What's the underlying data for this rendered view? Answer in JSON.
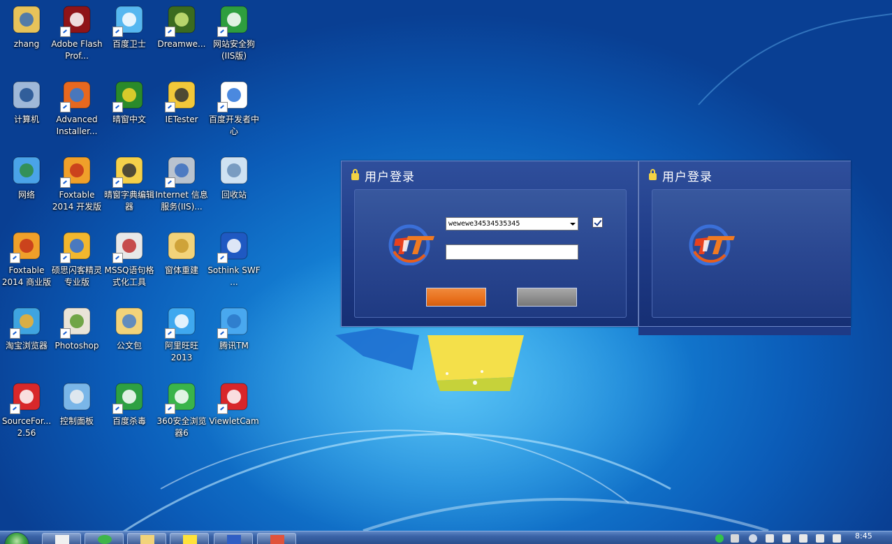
{
  "desktop": {
    "icons": [
      {
        "label": "zhang",
        "icon": "user-folder-icon"
      },
      {
        "label": "Adobe Flash Prof...",
        "icon": "flash-icon"
      },
      {
        "label": "百度卫士",
        "icon": "baidu-guard-icon"
      },
      {
        "label": "Dreamwe...",
        "icon": "dreamweaver-icon"
      },
      {
        "label": "网站安全狗(IIS版)",
        "icon": "safedog-icon"
      },
      {
        "label": "计算机",
        "icon": "computer-icon"
      },
      {
        "label": "Advanced Installer...",
        "icon": "advanced-installer-icon"
      },
      {
        "label": "晴窗中文",
        "icon": "qingchuang-icon"
      },
      {
        "label": "IETester",
        "icon": "ietester-icon"
      },
      {
        "label": "百度开发者中心",
        "icon": "baidu-dev-icon"
      },
      {
        "label": "网络",
        "icon": "network-icon"
      },
      {
        "label": "Foxtable 2014 开发版",
        "icon": "foxtable-icon"
      },
      {
        "label": "晴窗字典编辑器",
        "icon": "dictionary-editor-icon"
      },
      {
        "label": "Internet 信息服务(IIS)...",
        "icon": "iis-icon"
      },
      {
        "label": "回收站",
        "icon": "recycle-bin-icon"
      },
      {
        "label": "Foxtable 2014 商业版",
        "icon": "foxtable-icon"
      },
      {
        "label": "硕思闪客精灵 专业版",
        "icon": "sothink-decompiler-icon"
      },
      {
        "label": "MSSQ语句格式化工具",
        "icon": "sql-formatter-icon"
      },
      {
        "label": "窗体重建",
        "icon": "folder-icon"
      },
      {
        "label": "Sothink SWF ...",
        "icon": "sothink-swf-icon"
      },
      {
        "label": "淘宝浏览器",
        "icon": "taobao-browser-icon"
      },
      {
        "label": "Photoshop",
        "icon": "photoshop-icon"
      },
      {
        "label": "公文包",
        "icon": "briefcase-icon"
      },
      {
        "label": "阿里旺旺 2013",
        "icon": "aliwangwang-icon"
      },
      {
        "label": "腾讯TM",
        "icon": "tencent-tm-icon"
      },
      {
        "label": "SourceFor... 2.56",
        "icon": "sourceforge-icon"
      },
      {
        "label": "控制面板",
        "icon": "control-panel-icon"
      },
      {
        "label": "百度杀毒",
        "icon": "baidu-antivirus-icon"
      },
      {
        "label": "360安全浏览器6",
        "icon": "360-browser-icon"
      },
      {
        "label": "ViewletCam",
        "icon": "viewletcam-icon"
      }
    ]
  },
  "login_dialogs": [
    {
      "title": "用户登录",
      "username": "wewewe34534535345",
      "remember_checked": true
    },
    {
      "title": "用户登录"
    }
  ],
  "taskbar": {
    "clock": "8:45"
  },
  "colors": {
    "accent_orange": "#e8701d",
    "dialog_blue": "#1e3a86"
  }
}
